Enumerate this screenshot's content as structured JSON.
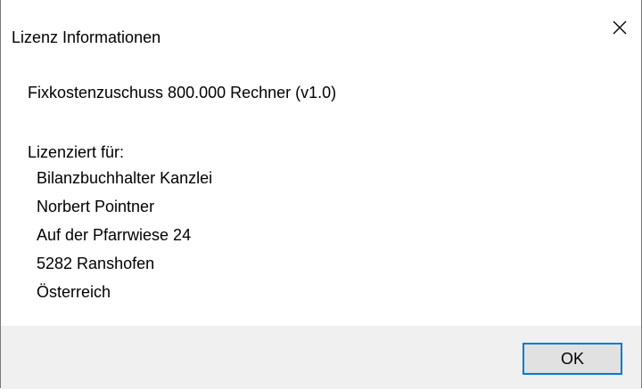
{
  "dialog": {
    "title": "Lizenz Informationen",
    "close_icon": "close-icon"
  },
  "content": {
    "product": "Fixkostenzuschuss 800.000 Rechner (v1.0)",
    "licensed_for_label": "Lizenziert für:",
    "licensee": [
      "Bilanzbuchhalter Kanzlei",
      "Norbert Pointner",
      "Auf der Pfarrwiese 24",
      "5282 Ranshofen",
      "Österreich"
    ]
  },
  "footer": {
    "ok_label": "OK"
  },
  "colors": {
    "accent": "#0078d7",
    "footer_bg": "#f0f0f0",
    "button_bg": "#e1e1e1"
  }
}
